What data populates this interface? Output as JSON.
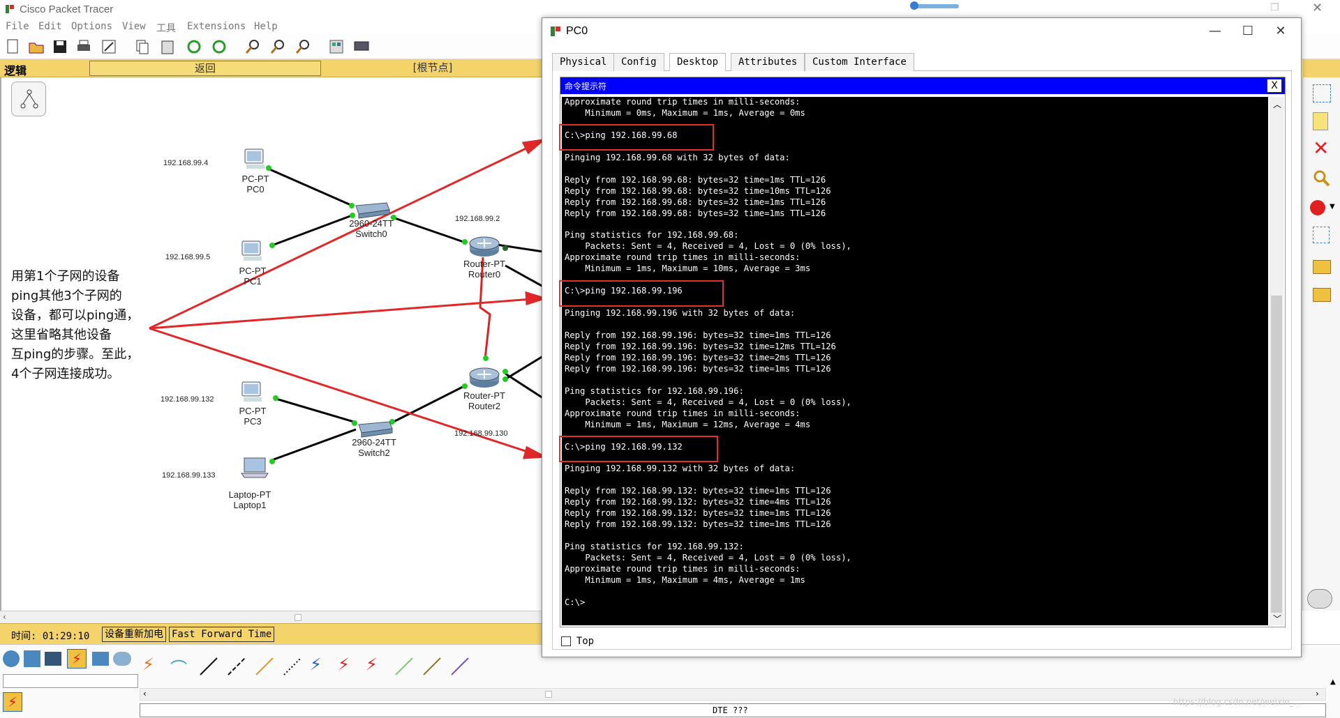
{
  "app": {
    "title": "Cisco Packet Tracer",
    "menu": [
      "File",
      "Edit",
      "Options",
      "View",
      "工具",
      "Extensions",
      "Help"
    ]
  },
  "nav": {
    "mode": "逻辑",
    "back": "返回",
    "root": "[根节点]"
  },
  "status": {
    "time": "时间: 01:29:10",
    "power_cycle": "设备重新加电",
    "fast_forward": "Fast Forward Time"
  },
  "bottom": {
    "connection_info": "DTE ???",
    "watermark": "https://blog.csdn.net/weixin_..."
  },
  "topology": {
    "devices": [
      {
        "type": "PC-PT",
        "name": "PC0",
        "ip": "192.168.99.4"
      },
      {
        "type": "PC-PT",
        "name": "PC1",
        "ip": "192.168.99.5"
      },
      {
        "type": "2960-24TT",
        "name": "Switch0"
      },
      {
        "type": "Router-PT",
        "name": "Router0",
        "ip": "192.168.99.2"
      },
      {
        "type": "Router-PT",
        "name": "Router2",
        "ip": "192.168.99.130"
      },
      {
        "type": "PC-PT",
        "name": "PC3",
        "ip": "192.168.99.132"
      },
      {
        "type": "2960-24TT",
        "name": "Switch2"
      },
      {
        "type": "Laptop-PT",
        "name": "Laptop1",
        "ip": "192.168.99.133"
      }
    ],
    "note": [
      "用第1个子网的设备",
      "ping其他3个子网的",
      "设备，都可以ping通，",
      "这里省略其他设备",
      "互ping的步骤。至此，",
      "4个子网连接成功。"
    ]
  },
  "dialog": {
    "title": "PC0",
    "tabs": [
      "Physical",
      "Config",
      "Desktop",
      "Attributes",
      "Custom Interface"
    ],
    "active_tab": "Desktop",
    "cmd_title": "命令提示符",
    "close_label": "X",
    "top_checkbox": "Top",
    "terminal_lines": [
      "Approximate round trip times in milli-seconds:",
      "    Minimum = 0ms, Maximum = 1ms, Average = 0ms",
      "",
      "C:\\>ping 192.168.99.68",
      "",
      "Pinging 192.168.99.68 with 32 bytes of data:",
      "",
      "Reply from 192.168.99.68: bytes=32 time=1ms TTL=126",
      "Reply from 192.168.99.68: bytes=32 time=10ms TTL=126",
      "Reply from 192.168.99.68: bytes=32 time=1ms TTL=126",
      "Reply from 192.168.99.68: bytes=32 time=1ms TTL=126",
      "",
      "Ping statistics for 192.168.99.68:",
      "    Packets: Sent = 4, Received = 4, Lost = 0 (0% loss),",
      "Approximate round trip times in milli-seconds:",
      "    Minimum = 1ms, Maximum = 10ms, Average = 3ms",
      "",
      "C:\\>ping 192.168.99.196",
      "",
      "Pinging 192.168.99.196 with 32 bytes of data:",
      "",
      "Reply from 192.168.99.196: bytes=32 time=1ms TTL=126",
      "Reply from 192.168.99.196: bytes=32 time=12ms TTL=126",
      "Reply from 192.168.99.196: bytes=32 time=2ms TTL=126",
      "Reply from 192.168.99.196: bytes=32 time=1ms TTL=126",
      "",
      "Ping statistics for 192.168.99.196:",
      "    Packets: Sent = 4, Received = 4, Lost = 0 (0% loss),",
      "Approximate round trip times in milli-seconds:",
      "    Minimum = 1ms, Maximum = 12ms, Average = 4ms",
      "",
      "C:\\>ping 192.168.99.132",
      "",
      "Pinging 192.168.99.132 with 32 bytes of data:",
      "",
      "Reply from 192.168.99.132: bytes=32 time=1ms TTL=126",
      "Reply from 192.168.99.132: bytes=32 time=4ms TTL=126",
      "Reply from 192.168.99.132: bytes=32 time=1ms TTL=126",
      "Reply from 192.168.99.132: bytes=32 time=1ms TTL=126",
      "",
      "Ping statistics for 192.168.99.132:",
      "    Packets: Sent = 4, Received = 4, Lost = 0 (0% loss),",
      "Approximate round trip times in milli-seconds:",
      "    Minimum = 1ms, Maximum = 4ms, Average = 1ms",
      "",
      "C:\\>"
    ]
  },
  "colors": {
    "yellow_bar": "#f4d36a",
    "cmd_title_blue": "#0000ff",
    "highlight_red": "#e03030",
    "link_green": "#22cc22"
  }
}
